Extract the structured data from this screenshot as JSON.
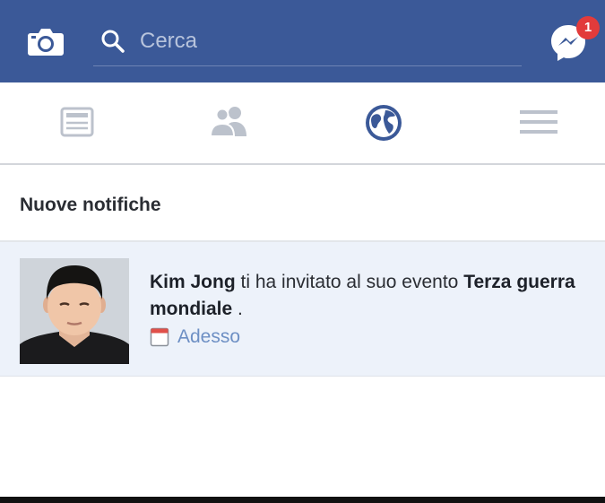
{
  "header": {
    "search_placeholder": "Cerca",
    "messenger_badge": "1",
    "bar_color": "#3b5998",
    "icons": [
      "camera-icon",
      "search-icon",
      "messenger-icon"
    ]
  },
  "tabs": [
    {
      "name": "news-feed",
      "icon": "news-feed-icon",
      "active": false
    },
    {
      "name": "friends",
      "icon": "friends-icon",
      "active": false
    },
    {
      "name": "notifications",
      "icon": "globe-icon",
      "active": true
    },
    {
      "name": "menu",
      "icon": "menu-icon",
      "active": false
    }
  ],
  "notifications": {
    "section_title": "Nuove notifiche",
    "items": [
      {
        "actor": "Kim Jong",
        "text": "ti ha invitato al suo evento",
        "event": "Terza guerra mondiale",
        "suffix": ".",
        "time": "Adesso",
        "icon": "calendar-icon",
        "unread": true
      }
    ]
  }
}
